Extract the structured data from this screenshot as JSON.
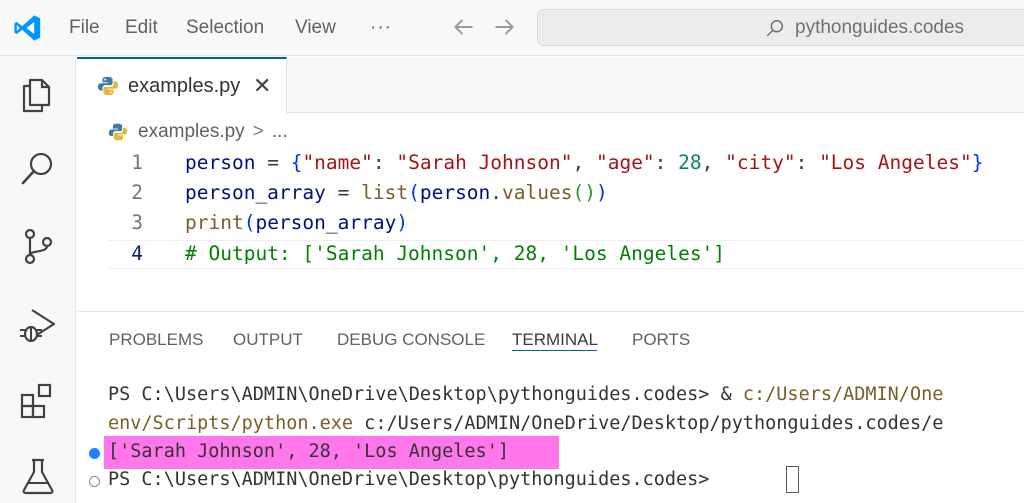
{
  "menu": {
    "items": [
      "File",
      "Edit",
      "Selection",
      "View"
    ],
    "more": "···"
  },
  "search": {
    "text": "pythonguides.codes"
  },
  "tab": {
    "label": "examples.py",
    "close": "✕"
  },
  "breadcrumb": {
    "file": "examples.py",
    "sep": ">",
    "more": "..."
  },
  "editor": {
    "line_numbers": [
      "1",
      "2",
      "3",
      "4"
    ],
    "line1": {
      "var": "person",
      "eq": " = ",
      "open": "{",
      "k1": "\"name\"",
      "c1": ": ",
      "v1": "\"Sarah Johnson\"",
      "s1": ", ",
      "k2": "\"age\"",
      "c2": ": ",
      "v2": "28",
      "s2": ", ",
      "k3": "\"city\"",
      "c3": ": ",
      "v3": "\"Los Angeles\"",
      "close": "}"
    },
    "line2": {
      "var": "person_array",
      "eq": " = ",
      "fn": "list",
      "p1": "(",
      "obj": "person",
      "dot": ".",
      "meth": "values",
      "p2": "()",
      "p3": ")"
    },
    "line3": {
      "fn": "print",
      "p1": "(",
      "arg": "person_array",
      "p2": ")"
    },
    "line4": {
      "comment": "# Output: ['Sarah Johnson', 28, 'Los Angeles']"
    }
  },
  "panel": {
    "tabs": [
      "PROBLEMS",
      "OUTPUT",
      "DEBUG CONSOLE",
      "TERMINAL",
      "PORTS"
    ],
    "active_tab": "TERMINAL"
  },
  "terminal": {
    "line1_prompt": "PS C:\\Users\\ADMIN\\OneDrive\\Desktop\\pythonguides.codes> & ",
    "line1_path": "c:/Users/ADMIN/One",
    "line2_path": "env/Scripts/python.exe",
    "line2_rest": " c:/Users/ADMIN/OneDrive/Desktop/pythonguides.codes/e",
    "output": "['Sarah Johnson', 28, 'Los Angeles']",
    "prompt": "PS C:\\Users\\ADMIN\\OneDrive\\Desktop\\pythonguides.codes> "
  },
  "colors": {
    "accent": "#005fb8",
    "highlight": "#ff5fe6",
    "logo": "#0098ff"
  },
  "icons": [
    "vscode-logo-icon",
    "arrow-left-icon",
    "arrow-right-icon",
    "search-icon",
    "explorer-icon",
    "search-sidebar-icon",
    "source-control-icon",
    "run-debug-icon",
    "extensions-icon",
    "testing-icon",
    "python-file-icon",
    "close-icon"
  ]
}
